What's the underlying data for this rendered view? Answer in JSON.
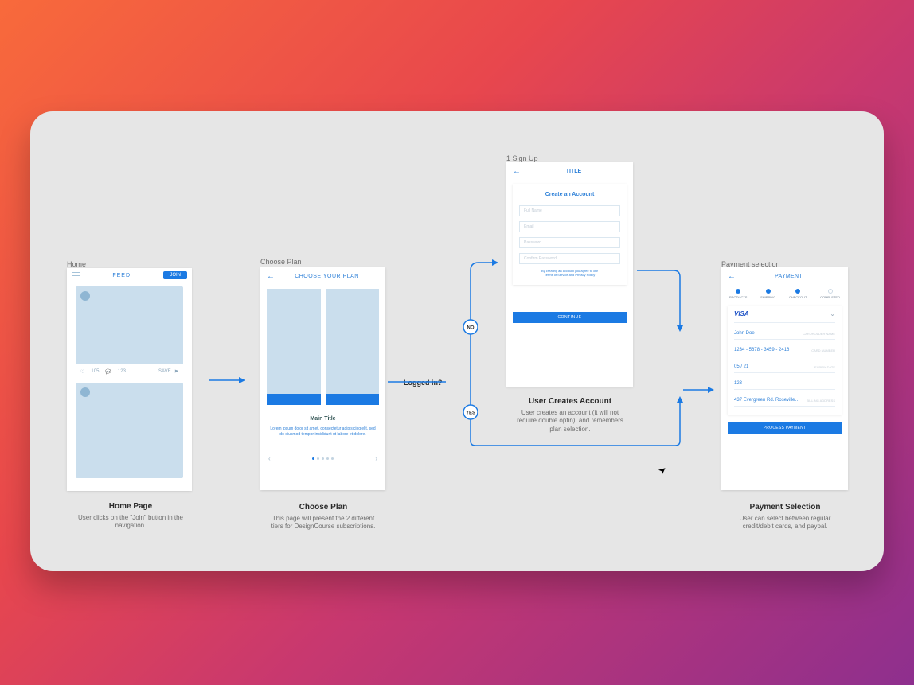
{
  "labels": {
    "home": "Home",
    "choosePlan": "Choose Plan",
    "signup": "1 Sign Up",
    "paymentSelection": "Payment selection"
  },
  "flow": {
    "loggedIn": "Logged in?",
    "no": "NO",
    "yes": "YES"
  },
  "home": {
    "feed": "FEED",
    "join": "JOIN",
    "likes": "105",
    "views": "123",
    "save": "SAVE"
  },
  "plan": {
    "title": "CHOOSE YOUR PLAN",
    "mainTitle": "Main Title",
    "lorem": "Lorem ipsum dolor sit amet, consectetur adipisicing elit, sed do eiusmod tempor incididunt ut labore et dolore."
  },
  "signup": {
    "title": "TITLE",
    "createAccount": "Create an Account",
    "fullName": "Full Name",
    "email": "Email",
    "password": "Password",
    "confirm": "Confirm Password",
    "termsPrefix": "By creating an account you agree to our",
    "termsLinks": "Terms of Service and Privacy Policy",
    "continue": "CONTINUE"
  },
  "payment": {
    "title": "PAYMENT",
    "steps": {
      "products": "PRODUCTS",
      "shipping": "SHIPPING",
      "checkout": "CHECKOUT",
      "completed": "COMPLETED"
    },
    "visa": "VISA",
    "name": "John Doe",
    "nameHint": "CARDHOLDER NAME",
    "cardNo": "1234 - 5678 - 3459 - 2416",
    "cardHint": "CARD NUMBER",
    "expiry": "05  /  21",
    "expiryHint": "EXPIRY DATE",
    "cvv": "123",
    "address": "437 Evergreen Rd. Roseville…",
    "addressHint": "BILLING ADDRESS",
    "process": "PROCESS PAYMENT"
  },
  "captions": {
    "home": {
      "title": "Home Page",
      "desc": "User clicks on the \"Join\" button in the navigation."
    },
    "plan": {
      "title": "Choose Plan",
      "desc": "This page will present the 2 different tiers for DesignCourse subscriptions."
    },
    "signup": {
      "title": "User Creates Account",
      "desc": "User creates an account (it will not require double optin), and remembers plan selection."
    },
    "payment": {
      "title": "Payment Selection",
      "desc": "User can select between regular credit/debit cards, and paypal."
    }
  }
}
